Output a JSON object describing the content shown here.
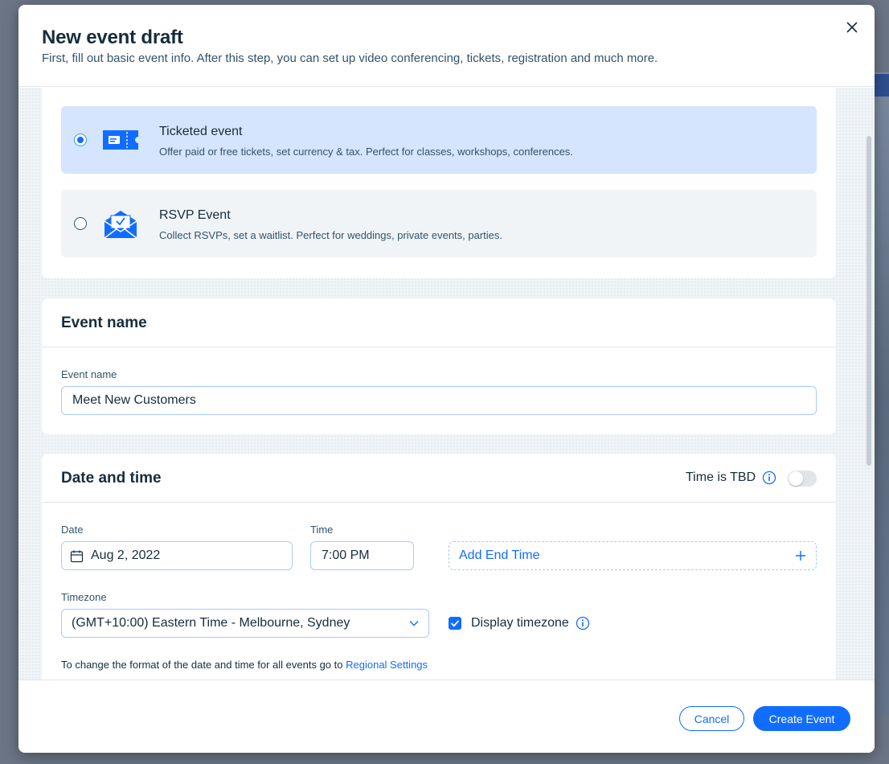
{
  "modal": {
    "title": "New event draft",
    "subtitle": "First, fill out basic event info. After this step, you can set up video conferencing, tickets, registration and much more."
  },
  "event_types": [
    {
      "title": "Ticketed event",
      "description": "Offer paid or free tickets, set currency & tax. Perfect for classes, workshops, conferences.",
      "icon": "ticket-icon",
      "selected": true
    },
    {
      "title": "RSVP Event",
      "description": "Collect RSVPs, set a waitlist. Perfect for weddings, private events, parties.",
      "icon": "envelope-icon",
      "selected": false
    }
  ],
  "event_name_section": {
    "title": "Event name",
    "field_label": "Event name",
    "value": "Meet New Customers"
  },
  "date_time_section": {
    "title": "Date and time",
    "tbd_label": "Time is TBD",
    "tbd_enabled": false,
    "date_label": "Date",
    "date_value": "Aug 2, 2022",
    "time_label": "Time",
    "time_value": "7:00 PM",
    "add_end_time_label": "Add End Time",
    "timezone_label": "Timezone",
    "timezone_value": "(GMT+10:00) Eastern Time - Melbourne, Sydney",
    "display_timezone_label": "Display timezone",
    "display_timezone_checked": true,
    "format_note": "To change the format of the date and time for all events go to",
    "regional_settings_link": "Regional Settings"
  },
  "footer": {
    "cancel_label": "Cancel",
    "create_label": "Create Event"
  },
  "colors": {
    "accent": "#116dff",
    "selected_bg": "#d5e5fd",
    "text_primary": "#162d3d"
  }
}
